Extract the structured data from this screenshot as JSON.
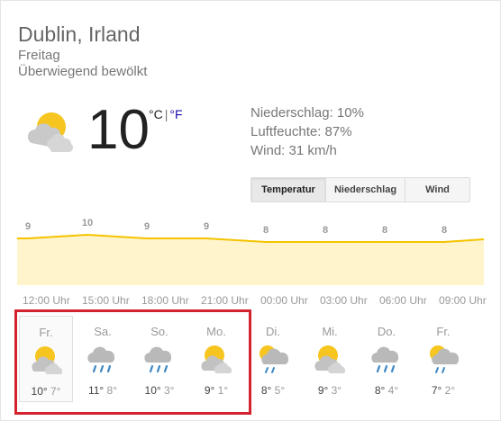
{
  "location": "Dublin, Irland",
  "day": "Freitag",
  "condition": "Überwiegend bewölkt",
  "current": {
    "temp": "10",
    "unit_c": "°C",
    "sep": "|",
    "unit_f": "°F",
    "icon": "partly-cloudy-icon"
  },
  "details": {
    "precip": "Niederschlag: 10%",
    "humidity": "Luftfeuchte: 87%",
    "wind": "Wind: 31 km/h"
  },
  "tabs": [
    "Temperatur",
    "Niederschlag",
    "Wind"
  ],
  "colors": {
    "chart_line": "#f5c300",
    "chart_fill": "#fff4cc",
    "highlight": "#d3232f",
    "link": "#1a0dab"
  },
  "chart_data": {
    "type": "area",
    "x": [
      "12:00 Uhr",
      "15:00 Uhr",
      "18:00 Uhr",
      "21:00 Uhr",
      "00:00 Uhr",
      "03:00 Uhr",
      "06:00 Uhr",
      "09:00 Uhr"
    ],
    "values": [
      9,
      10,
      9,
      9,
      8,
      8,
      8,
      8
    ],
    "labels": [
      "9",
      "10",
      "9",
      "9",
      "8",
      "8",
      "8",
      "8"
    ]
  },
  "forecast": [
    {
      "day": "Fr.",
      "hi": "10°",
      "lo": "7°",
      "icon": "partly-cloudy-icon"
    },
    {
      "day": "Sa.",
      "hi": "11°",
      "lo": "8°",
      "icon": "rain-icon"
    },
    {
      "day": "So.",
      "hi": "10°",
      "lo": "3°",
      "icon": "rain-icon"
    },
    {
      "day": "Mo.",
      "hi": "9°",
      "lo": "1°",
      "icon": "partly-cloudy-icon"
    },
    {
      "day": "Di.",
      "hi": "8°",
      "lo": "5°",
      "icon": "sun-rain-icon"
    },
    {
      "day": "Mi.",
      "hi": "9°",
      "lo": "3°",
      "icon": "partly-cloudy-icon"
    },
    {
      "day": "Do.",
      "hi": "8°",
      "lo": "4°",
      "icon": "rain-icon"
    },
    {
      "day": "Fr.",
      "hi": "7°",
      "lo": "2°",
      "icon": "sun-rain-icon"
    }
  ]
}
